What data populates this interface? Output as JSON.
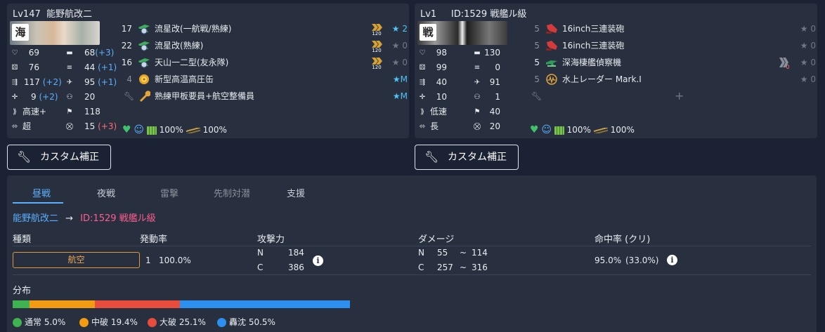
{
  "ally": {
    "level": "Lv147",
    "name": "能野航改二",
    "banner_kanji": "海",
    "stats": {
      "hp": "69",
      "firepower": "68",
      "firepower_bonus": "(+3)",
      "armor": "76",
      "torpedo": "44",
      "torpedo_bonus": "(+1)",
      "evasion": "117",
      "evasion_bonus": "(+2)",
      "aa": "95",
      "aa_bonus": "(+1)",
      "asw": "9",
      "asw_bonus": "(+2)",
      "los": "20",
      "speed": "高速+",
      "luck": "118",
      "range": "超",
      "plane_count": "15",
      "plane_bonus": "(+3)"
    },
    "equipment": [
      {
        "slot": "17",
        "name": "流星改(一航戦/熟練)",
        "icon": "green-torpedo-bomber-icon",
        "prof": "120",
        "improve": "★ 2",
        "improve_on": true
      },
      {
        "slot": "22",
        "name": "流星改(熟練)",
        "icon": "green-torpedo-bomber-icon",
        "prof": "120",
        "improve": "★ 0",
        "improve_on": false
      },
      {
        "slot": "16",
        "name": "天山一二型(友永隊)",
        "icon": "green-torpedo-bomber-icon",
        "prof": "120",
        "improve": "★ 0",
        "improve_on": false
      },
      {
        "slot": "4",
        "name": "新型高温高圧缶",
        "icon": "boiler-icon",
        "prof": "",
        "improve": "★M",
        "improve_on": true
      },
      {
        "slot": "",
        "name": "熟練甲板要員+航空整備員",
        "icon": "wrench-icon",
        "prof": "",
        "improve": "★M",
        "improve_on": true
      }
    ],
    "status": {
      "morale": "100%",
      "fuel": "100%"
    }
  },
  "enemy": {
    "level": "Lv1",
    "name": "ID:1529 戦艦ル級",
    "banner_kanji": "戦",
    "stats": {
      "hp": "98",
      "firepower": "130",
      "armor": "99",
      "torpedo": "0",
      "evasion": "40",
      "aa": "91",
      "asw": "10",
      "los": "1",
      "speed": "低速",
      "luck": "40",
      "range": "長",
      "plane_count": "20"
    },
    "equipment": [
      {
        "slot": "5",
        "name": "16inch三連装砲",
        "icon": "red-main-gun-icon",
        "prof": "",
        "improve": "★ 0",
        "improve_on": false
      },
      {
        "slot": "5",
        "name": "16inch三連装砲",
        "icon": "red-main-gun-icon",
        "prof": "",
        "improve": "★ 0",
        "improve_on": false
      },
      {
        "slot": "5",
        "name": "深海棲艦偵察機",
        "icon": "green-seaplane-icon",
        "prof": "0",
        "improve": "★ 0",
        "improve_on": false
      },
      {
        "slot": "5",
        "name": "水上レーダー Mark.I",
        "icon": "radar-icon",
        "prof": "",
        "improve": "★ 0",
        "improve_on": false
      }
    ],
    "status": {
      "morale": "100%",
      "fuel": "100%"
    }
  },
  "buttons": {
    "custom_fix": "カスタム補正"
  },
  "tabs": [
    "昼戦",
    "夜戦",
    "雷撃",
    "先制対潜",
    "支援"
  ],
  "breadcrumb": {
    "attacker": "能野航改二",
    "arrow": "→",
    "defender": "ID:1529 戦艦ル級"
  },
  "table": {
    "headers": {
      "type": "種類",
      "rate": "発動率",
      "attack": "攻撃力",
      "damage": "ダメージ",
      "hit": "命中率 (クリ)"
    },
    "row": {
      "type": "航空",
      "rate_count": "1",
      "rate": "100.0%",
      "attack_n_label": "N",
      "attack_n": "184",
      "attack_c_label": "C",
      "attack_c": "386",
      "damage_n_label": "N",
      "damage_n_min": "55",
      "damage_n_max": "114",
      "damage_c_label": "C",
      "damage_c_min": "257",
      "damage_c_max": "316",
      "tilde": "~",
      "hit": "95.0%",
      "crit": "(33.0%)"
    }
  },
  "distribution": {
    "title": "分布",
    "segments": [
      {
        "label": "通常",
        "value": "5.0%",
        "pct": 5.0,
        "color": "#3fb34f"
      },
      {
        "label": "中破",
        "value": "19.4%",
        "pct": 19.4,
        "color": "#f39c12"
      },
      {
        "label": "大破",
        "value": "25.1%",
        "pct": 25.1,
        "color": "#e84c3d"
      },
      {
        "label": "轟沈",
        "value": "50.5%",
        "pct": 50.5,
        "color": "#2d8ff0"
      }
    ]
  }
}
